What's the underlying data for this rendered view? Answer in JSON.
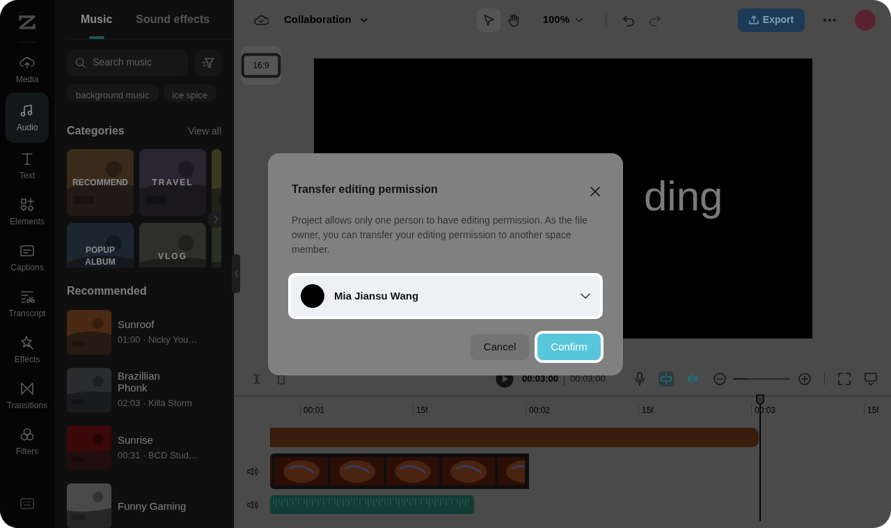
{
  "rail": {
    "items": [
      {
        "label": "Media",
        "selected": false
      },
      {
        "label": "Audio",
        "selected": true
      },
      {
        "label": "Text",
        "selected": false
      },
      {
        "label": "Elements",
        "selected": false
      },
      {
        "label": "Captions",
        "selected": false
      },
      {
        "label": "Transcript",
        "selected": false
      },
      {
        "label": "Effects",
        "selected": false
      },
      {
        "label": "Transitions",
        "selected": false
      },
      {
        "label": "Filters",
        "selected": false
      }
    ]
  },
  "panel": {
    "tabs": [
      {
        "label": "Music",
        "selected": true
      },
      {
        "label": "Sound effects",
        "selected": false
      }
    ],
    "search": {
      "placeholder": "Search music"
    },
    "chips": [
      "background music",
      "ice spice"
    ],
    "categories": {
      "title": "Categories",
      "link": "View all",
      "tiles": [
        {
          "kind": "category",
          "label": "RECOMMEND"
        },
        {
          "kind": "category",
          "label": "TRAVEL"
        },
        {
          "kind": "picture"
        },
        {
          "kind": "category",
          "label": "POPUP\nALBUM"
        },
        {
          "kind": "category",
          "label": "VLOG"
        },
        {
          "kind": "picture"
        }
      ]
    },
    "recommended": {
      "title": "Recommended",
      "tracks": [
        {
          "title": "Sunroof",
          "meta": "01:00 · Nicky You…"
        },
        {
          "title": "Brazillian\nPhonk",
          "meta": "02:03 · Killa Storm"
        },
        {
          "title": "Sunrise",
          "meta": "00:31 · BCD Stud…"
        },
        {
          "title": "Funny Gaming"
        }
      ]
    }
  },
  "topbar": {
    "project": "Collaboration",
    "zoom": "100%",
    "redo_disabled": true,
    "export": "Export"
  },
  "canvas": {
    "ratio": "16:9",
    "text": "ding"
  },
  "timeline": {
    "current": "00:03:00",
    "total": "00:03:00",
    "zoom_slider": {
      "level": 0.25
    },
    "ruler": [
      "00:01",
      "15f",
      "00:02",
      "15f",
      "00:03",
      "15f"
    ]
  },
  "dialog": {
    "title": "Transfer editing permission",
    "body": "Project allows only one person to have editing permission. As the file owner, you can transfer your editing permission to another space member.",
    "member": {
      "name": "Mia Jiansu Wang",
      "highlighted": true
    },
    "buttons": [
      {
        "label": "Cancel",
        "kind": "secondary",
        "highlighted": false
      },
      {
        "label": "Confirm",
        "kind": "primary",
        "highlighted": true
      }
    ]
  }
}
